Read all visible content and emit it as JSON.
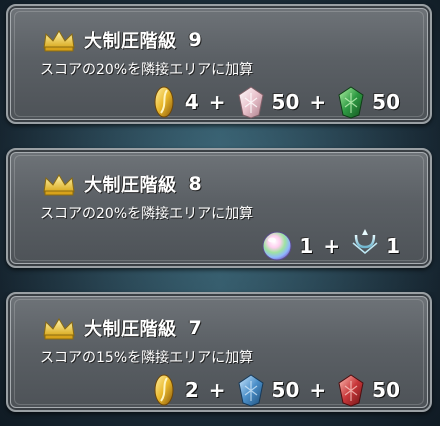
{
  "rewards_list": [
    {
      "title": "大制圧階級",
      "level": "9",
      "description": "スコアの20%を隣接エリアに加算",
      "items": [
        {
          "icon": "gold-feather-icon",
          "qty": "4"
        },
        {
          "icon": "pink-crystal-badge-icon",
          "qty": "50"
        },
        {
          "icon": "green-crystal-badge-icon",
          "qty": "50"
        }
      ]
    },
    {
      "title": "大制圧階級",
      "level": "8",
      "description": "スコアの20%を隣接エリアに加算",
      "items": [
        {
          "icon": "rainbow-orb-icon",
          "qty": "1"
        },
        {
          "icon": "divine-dew-trident-icon",
          "qty": "1"
        }
      ]
    },
    {
      "title": "大制圧階級",
      "level": "7",
      "description": "スコアの15%を隣接エリアに加算",
      "items": [
        {
          "icon": "gold-feather-icon",
          "qty": "2"
        },
        {
          "icon": "blue-crystal-badge-icon",
          "qty": "50"
        },
        {
          "icon": "red-crystal-badge-icon",
          "qty": "50"
        }
      ]
    }
  ],
  "plus_sign": "+",
  "colors": {
    "panel": "#5e6368",
    "gold": "#e9b72a",
    "pink_badge": "#e9c2cc",
    "green_badge": "#2e9a43",
    "blue_badge": "#4b8fc9",
    "red_badge": "#c8373a"
  }
}
